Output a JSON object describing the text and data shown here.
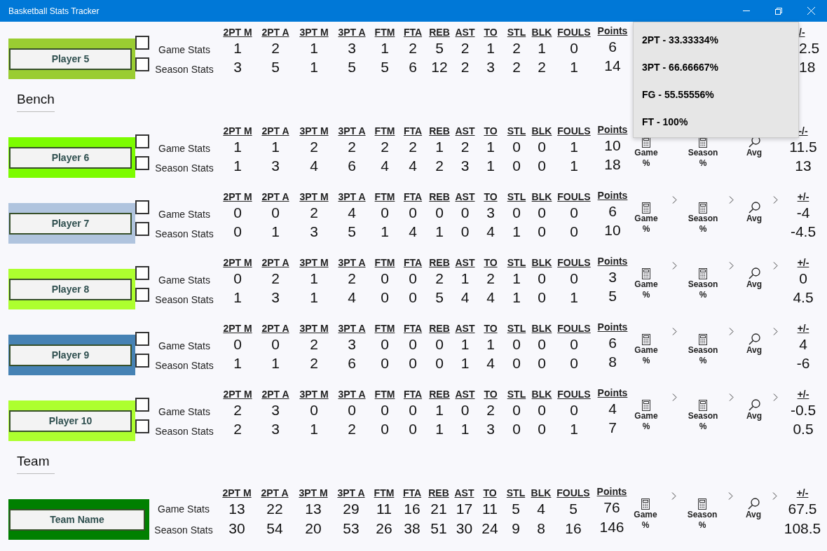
{
  "window": {
    "title": "Basketball Stats Tracker"
  },
  "popup": {
    "lines": [
      "2PT - 33.33334%",
      "3PT - 66.66667%",
      "FG - 55.55556%",
      "FT - 100%"
    ]
  },
  "sections": [
    {
      "rows": [
        {
          "kind": "player",
          "name": "Player 5",
          "color": "#9acd32",
          "game_checked": false,
          "season_checked": false,
          "game_label": "Game Stats",
          "season_label": "Season Stats",
          "columns": [
            "2PT M",
            "2PT A",
            "3PT M",
            "3PT A",
            "FTM",
            "FTA",
            "REB",
            "AST",
            "TO",
            "STL",
            "BLK",
            "FOULS"
          ],
          "game": [
            "1",
            "2",
            "1",
            "3",
            "1",
            "2",
            "5",
            "2",
            "1",
            "2",
            "1",
            "0"
          ],
          "season": [
            "3",
            "5",
            "1",
            "5",
            "5",
            "6",
            "12",
            "2",
            "3",
            "2",
            "2",
            "1"
          ],
          "points": {
            "header": "Points",
            "game": "6",
            "season": "14"
          },
          "plus_minus": {
            "header": "/-",
            "game": "2.5",
            "season": "18"
          }
        }
      ]
    },
    {
      "heading": "Bench",
      "rows": [
        {
          "kind": "player",
          "name": "Player 6",
          "color": "#7cfc00",
          "game_checked": false,
          "season_checked": false,
          "game_label": "Game Stats",
          "season_label": "Season Stats",
          "columns": [
            "2PT M",
            "2PT A",
            "3PT M",
            "3PT A",
            "FTM",
            "FTA",
            "REB",
            "AST",
            "TO",
            "STL",
            "BLK",
            "FOULS"
          ],
          "game": [
            "1",
            "1",
            "2",
            "2",
            "2",
            "2",
            "1",
            "2",
            "1",
            "0",
            "0",
            "1"
          ],
          "season": [
            "1",
            "3",
            "4",
            "6",
            "4",
            "4",
            "2",
            "3",
            "1",
            "0",
            "0",
            "1"
          ],
          "points": {
            "header": "Points",
            "game": "10",
            "season": "18"
          },
          "actions": [
            {
              "kind": "plain",
              "label": "Game",
              "sub": "%"
            },
            {
              "kind": "plain",
              "label": "Season",
              "sub": "%"
            },
            {
              "kind": "plain",
              "label": "Avg"
            }
          ],
          "plus_minus": {
            "header": "-/-",
            "game": "11.5",
            "season": "13"
          }
        },
        {
          "kind": "player",
          "name": "Player 7",
          "color": "#b0c4de",
          "game_checked": false,
          "season_checked": false,
          "game_label": "Game Stats",
          "season_label": "Season Stats",
          "columns": [
            "2PT M",
            "2PT A",
            "3PT M",
            "3PT A",
            "FTM",
            "FTA",
            "REB",
            "AST",
            "TO",
            "STL",
            "BLK",
            "FOULS"
          ],
          "game": [
            "0",
            "0",
            "2",
            "4",
            "0",
            "0",
            "0",
            "0",
            "3",
            "0",
            "0",
            "0"
          ],
          "season": [
            "0",
            "1",
            "3",
            "5",
            "1",
            "4",
            "1",
            "0",
            "4",
            "1",
            "0",
            "0"
          ],
          "points": {
            "header": "Points",
            "game": "6",
            "season": "10"
          },
          "actions": [
            {
              "kind": "with_chevron",
              "label": "Game",
              "sub": "%"
            },
            {
              "kind": "with_chevron",
              "label": "Season",
              "sub": "%"
            },
            {
              "kind": "with_chevron",
              "label": "Avg"
            }
          ],
          "plus_minus": {
            "header": "+/-",
            "game": "-4",
            "season": "-4.5"
          }
        },
        {
          "kind": "player",
          "name": "Player 8",
          "color": "#adff2f",
          "game_checked": false,
          "season_checked": false,
          "game_label": "Game Stats",
          "season_label": "Season Stats",
          "columns": [
            "2PT M",
            "2PT A",
            "3PT M",
            "3PT A",
            "FTM",
            "FTA",
            "REB",
            "AST",
            "TO",
            "STL",
            "BLK",
            "FOULS"
          ],
          "game": [
            "0",
            "2",
            "1",
            "2",
            "0",
            "0",
            "2",
            "1",
            "2",
            "1",
            "0",
            "0"
          ],
          "season": [
            "1",
            "3",
            "1",
            "4",
            "0",
            "0",
            "5",
            "4",
            "4",
            "1",
            "0",
            "1"
          ],
          "points": {
            "header": "Points",
            "game": "3",
            "season": "5"
          },
          "actions": [
            {
              "kind": "with_chevron",
              "label": "Game",
              "sub": "%"
            },
            {
              "kind": "with_chevron",
              "label": "Season",
              "sub": "%"
            },
            {
              "kind": "with_chevron",
              "label": "Avg"
            }
          ],
          "plus_minus": {
            "header": "+/-",
            "game": "0",
            "season": "4.5"
          }
        },
        {
          "kind": "player",
          "name": "Player 9",
          "color": "#4682b4",
          "game_checked": false,
          "season_checked": false,
          "game_label": "Game Stats",
          "season_label": "Season Stats",
          "columns": [
            "2PT M",
            "2PT A",
            "3PT M",
            "3PT A",
            "FTM",
            "FTA",
            "REB",
            "AST",
            "TO",
            "STL",
            "BLK",
            "FOULS"
          ],
          "game": [
            "0",
            "0",
            "2",
            "3",
            "0",
            "0",
            "0",
            "1",
            "1",
            "0",
            "0",
            "0"
          ],
          "season": [
            "1",
            "1",
            "2",
            "6",
            "0",
            "0",
            "0",
            "1",
            "4",
            "0",
            "0",
            "0"
          ],
          "points": {
            "header": "Points",
            "game": "6",
            "season": "8"
          },
          "actions": [
            {
              "kind": "with_chevron",
              "label": "Game",
              "sub": "%"
            },
            {
              "kind": "with_chevron",
              "label": "Season",
              "sub": "%"
            },
            {
              "kind": "with_chevron",
              "label": "Avg"
            }
          ],
          "plus_minus": {
            "header": "+/-",
            "game": "4",
            "season": "-6"
          }
        },
        {
          "kind": "player",
          "name": "Player 10",
          "color": "#adff2f",
          "game_checked": false,
          "season_checked": false,
          "game_label": "Game Stats",
          "season_label": "Season Stats",
          "columns": [
            "2PT M",
            "2PT A",
            "3PT M",
            "3PT A",
            "FTM",
            "FTA",
            "REB",
            "AST",
            "TO",
            "STL",
            "BLK",
            "FOULS"
          ],
          "game": [
            "2",
            "3",
            "0",
            "0",
            "0",
            "0",
            "1",
            "0",
            "2",
            "0",
            "0",
            "0"
          ],
          "season": [
            "2",
            "3",
            "1",
            "2",
            "0",
            "0",
            "1",
            "1",
            "3",
            "0",
            "0",
            "1"
          ],
          "points": {
            "header": "Points",
            "game": "4",
            "season": "7"
          },
          "actions": [
            {
              "kind": "with_chevron",
              "label": "Game",
              "sub": "%"
            },
            {
              "kind": "with_chevron",
              "label": "Season",
              "sub": "%"
            },
            {
              "kind": "with_chevron",
              "label": "Avg"
            }
          ],
          "plus_minus": {
            "header": "+/-",
            "game": "-0.5",
            "season": "0.5"
          }
        }
      ]
    },
    {
      "heading": "Team",
      "rows": [
        {
          "kind": "team",
          "name": "Team Name",
          "color": "#008000",
          "game_label": "Game Stats",
          "season_label": "Season Stats",
          "columns": [
            "2PT M",
            "2PT A",
            "3PT M",
            "3PT A",
            "FTM",
            "FTA",
            "REB",
            "AST",
            "TO",
            "STL",
            "BLK",
            "FOULS"
          ],
          "game": [
            "13",
            "22",
            "13",
            "29",
            "11",
            "16",
            "21",
            "17",
            "11",
            "5",
            "4",
            "5"
          ],
          "season": [
            "30",
            "54",
            "20",
            "53",
            "26",
            "38",
            "51",
            "30",
            "24",
            "9",
            "8",
            "16"
          ],
          "points": {
            "header": "Points",
            "game": "76",
            "season": "146"
          },
          "actions": [
            {
              "kind": "with_chevron",
              "label": "Game",
              "sub": "%"
            },
            {
              "kind": "with_chevron",
              "label": "Season",
              "sub": "%"
            },
            {
              "kind": "with_chevron",
              "label": "Avg"
            }
          ],
          "plus_minus": {
            "header": "+/-",
            "game": "67.5",
            "season": "108.5"
          }
        }
      ]
    }
  ]
}
